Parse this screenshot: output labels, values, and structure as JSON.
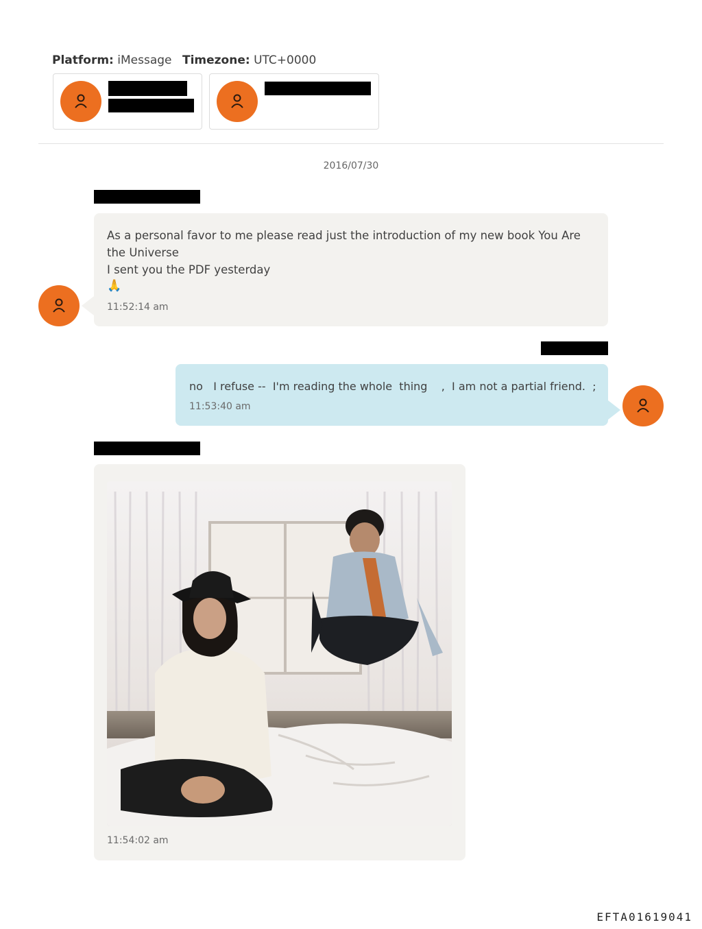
{
  "header": {
    "platform_label": "Platform:",
    "platform_value": "iMessage",
    "timezone_label": "Timezone:",
    "timezone_value": "UTC+0000"
  },
  "participants": [
    {
      "icon": "person-icon",
      "name": "[redacted]"
    },
    {
      "icon": "person-icon",
      "name": "[redacted]"
    }
  ],
  "conversation": {
    "date": "2016/07/30",
    "messages": [
      {
        "direction": "incoming",
        "sender": "[redacted]",
        "text": "As a personal favor to me please read just the introduction of my new book You Are\nthe Universe\nI sent you the PDF yesterday",
        "emoji": "🙏",
        "time": "11:52:14 am"
      },
      {
        "direction": "outgoing",
        "sender": "[redacted]",
        "text": "no   I refuse --  I'm reading the whole  thing    ,  I am not a partial friend.  ;",
        "time": "11:53:40 am"
      },
      {
        "direction": "incoming",
        "sender": "[redacted]",
        "attachment": "photo",
        "time": "11:54:02 am"
      }
    ]
  },
  "colors": {
    "avatar": "#ec6f20",
    "incoming_bubble": "#f3f2ef",
    "outgoing_bubble": "#cde9f0"
  },
  "footer": {
    "doc_id": "EFTA01619041"
  }
}
